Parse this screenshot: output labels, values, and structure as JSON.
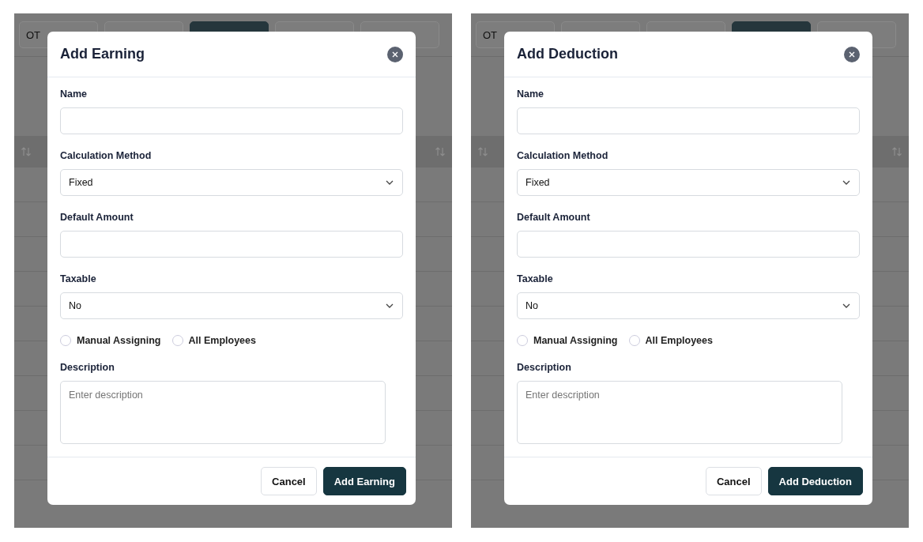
{
  "panels": [
    {
      "tabs": [
        {
          "label": "OT",
          "selected": false
        },
        {
          "selected": false
        },
        {
          "selected": true
        },
        {
          "selected": false
        },
        {
          "selected": false
        }
      ],
      "modal": {
        "title": "Add Earning",
        "fields": [
          {
            "kind": "text",
            "label": "Name"
          },
          {
            "kind": "select",
            "label": "Calculation Method",
            "value": "Fixed"
          },
          {
            "kind": "text",
            "label": "Default Amount"
          },
          {
            "kind": "select",
            "label": "Taxable",
            "value": "No"
          },
          {
            "kind": "radios",
            "options": [
              {
                "label": "Manual Assigning",
                "selected": false
              },
              {
                "label": "All Employees",
                "selected": false
              }
            ]
          },
          {
            "kind": "textarea",
            "label": "Description",
            "placeholder": "Enter description"
          }
        ],
        "buttons": [
          {
            "label": "Cancel",
            "kind": "secondary"
          },
          {
            "label": "Add Earning",
            "kind": "primary"
          }
        ]
      }
    },
    {
      "tabs": [
        {
          "label": "OT",
          "selected": false
        },
        {
          "selected": false
        },
        {
          "selected": false
        },
        {
          "selected": true
        },
        {
          "selected": false
        }
      ],
      "modal": {
        "title": "Add Deduction",
        "fields": [
          {
            "kind": "text",
            "label": "Name"
          },
          {
            "kind": "select",
            "label": "Calculation Method",
            "value": "Fixed"
          },
          {
            "kind": "text",
            "label": "Default Amount"
          },
          {
            "kind": "select",
            "label": "Taxable",
            "value": "No"
          },
          {
            "kind": "radios",
            "options": [
              {
                "label": "Manual Assigning",
                "selected": false
              },
              {
                "label": "All Employees",
                "selected": false
              }
            ]
          },
          {
            "kind": "textarea",
            "label": "Description",
            "placeholder": "Enter description"
          }
        ],
        "buttons": [
          {
            "label": "Cancel",
            "kind": "secondary"
          },
          {
            "label": "Add Deduction",
            "kind": "primary"
          }
        ]
      }
    }
  ]
}
